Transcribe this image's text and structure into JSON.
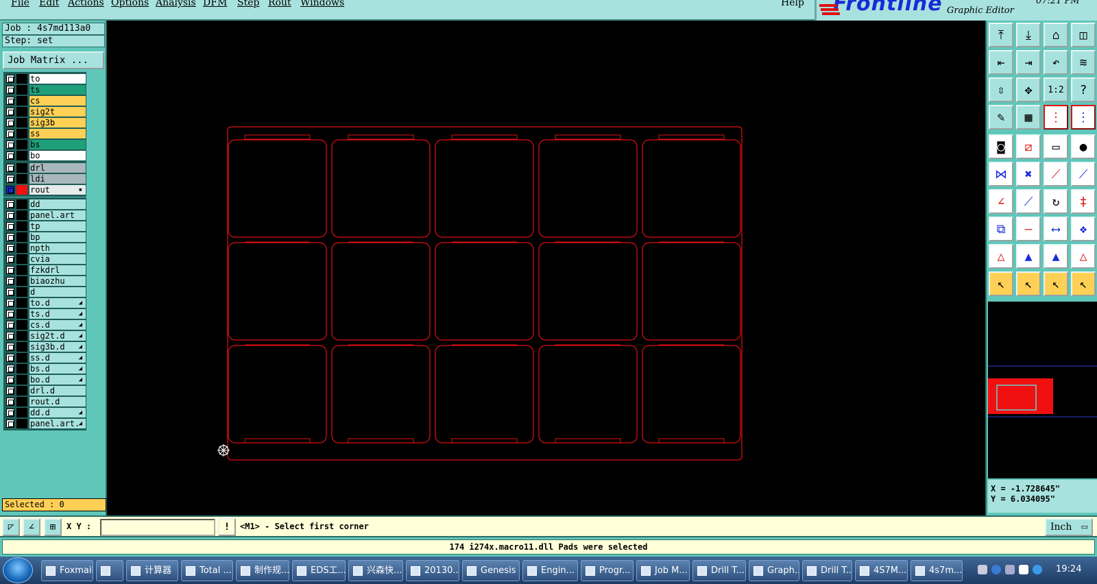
{
  "menu": {
    "items": [
      "File",
      "Edit",
      "Actions",
      "Options",
      "Analysis",
      "DFM",
      "Step",
      "Rout",
      "Windows"
    ],
    "help": "Help"
  },
  "brand": {
    "logo": "Frontline",
    "subtitle": "Graphic Editor",
    "clock": "07:21 PM"
  },
  "left": {
    "job": "Job : 4s7md113a0",
    "step": "Step: set",
    "job_matrix": "Job Matrix ...",
    "groups": [
      [
        {
          "name": "to",
          "color": "#ffffff"
        },
        {
          "name": "ts",
          "color": "#1fa07a"
        },
        {
          "name": "cs",
          "color": "#ffd056"
        },
        {
          "name": "sig2t",
          "color": "#ffd056"
        },
        {
          "name": "sig3b",
          "color": "#ffd056"
        },
        {
          "name": "ss",
          "color": "#ffd056"
        },
        {
          "name": "bs",
          "color": "#1fa07a"
        },
        {
          "name": "bo",
          "color": "#ffffff"
        }
      ],
      [
        {
          "name": "drl",
          "color": "#a8b8bc"
        },
        {
          "name": "ldi",
          "color": "#a8b8bc"
        },
        {
          "name": "rout",
          "color": "#e6ecec",
          "active": true,
          "mark": "▪"
        }
      ],
      [
        {
          "name": "dd",
          "color": "#a8e2de"
        },
        {
          "name": "panel.art",
          "color": "#a8e2de"
        },
        {
          "name": "tp",
          "color": "#a8e2de"
        },
        {
          "name": "bp",
          "color": "#a8e2de"
        },
        {
          "name": "npth",
          "color": "#a8e2de"
        },
        {
          "name": "cvia",
          "color": "#a8e2de"
        },
        {
          "name": "fzkdrl",
          "color": "#a8e2de"
        },
        {
          "name": "biaozhu",
          "color": "#a8e2de"
        },
        {
          "name": "d",
          "color": "#a8e2de"
        },
        {
          "name": "to.d",
          "color": "#a8e2de",
          "mark": "◢"
        },
        {
          "name": "ts.d",
          "color": "#a8e2de",
          "mark": "◢"
        },
        {
          "name": "cs.d",
          "color": "#a8e2de",
          "mark": "◢"
        },
        {
          "name": "sig2t.d",
          "color": "#a8e2de",
          "mark": "◢"
        },
        {
          "name": "sig3b.d",
          "color": "#a8e2de",
          "mark": "◢"
        },
        {
          "name": "ss.d",
          "color": "#a8e2de",
          "mark": "◢"
        },
        {
          "name": "bs.d",
          "color": "#a8e2de",
          "mark": "◢"
        },
        {
          "name": "bo.d",
          "color": "#a8e2de",
          "mark": "◢"
        },
        {
          "name": "drl.d",
          "color": "#a8e2de"
        },
        {
          "name": "rout.d",
          "color": "#a8e2de"
        },
        {
          "name": "dd.d",
          "color": "#a8e2de",
          "mark": "◢"
        },
        {
          "name": "panel.art.",
          "color": "#a8e2de",
          "mark": "◢"
        }
      ]
    ],
    "selected": "Selected : 0"
  },
  "canvas": {
    "background": "#000000",
    "outline_color": "#e01010",
    "grid": {
      "cols": 5,
      "rows": 3
    }
  },
  "right": {
    "tools": [
      "send-top-icon",
      "send-bottom-icon",
      "home-icon",
      "window-icon",
      "pan-left-icon",
      "pan-right-icon",
      "undo-view-icon",
      "redraw-icon",
      "fit-vertical-icon",
      "zoom-center-icon",
      "scale-1-2-icon",
      "help-icon",
      "palette-icon",
      "grid-icon",
      "snap-red-icon",
      "snap-blue-icon",
      "pad-icon",
      "line-icon",
      "ruler-icon",
      "circle-icon",
      "connect-icon",
      "cross-icon",
      "node-icon",
      "line-node-icon",
      "angle-icon",
      "edge-icon",
      "arc-icon",
      "ff-icon",
      "move-icon",
      "dash-icon",
      "dimension-icon",
      "group-icon",
      "tri-red-icon",
      "tri-blue-icon",
      "tri-red-blue-icon",
      "tri-dash-icon",
      "pointer-icon",
      "pointer-box-icon",
      "pointer-circle-icon",
      "pointer-path-icon"
    ],
    "coords": {
      "x": "X = -1.728645\"",
      "y": "Y = 6.034095\""
    }
  },
  "command": {
    "xy_label": "X Y :",
    "xy_value": "",
    "excl": "!",
    "prompt": "<M1> - Select first corner",
    "unit": "Inch"
  },
  "status": "174 i274x.macro11.dll Pads were selected",
  "taskbar": {
    "tasks": [
      "Foxmail",
      "",
      "计算器",
      "Total ...",
      "制作规...",
      "EDS工...",
      "兴森快...",
      "20130...",
      "Genesis",
      "Engin...",
      "Progr...",
      "Job M...",
      "Drill T...",
      "Graph...",
      "Drill T...",
      "4S7M...",
      "4s7m..."
    ],
    "time": "19:24"
  }
}
